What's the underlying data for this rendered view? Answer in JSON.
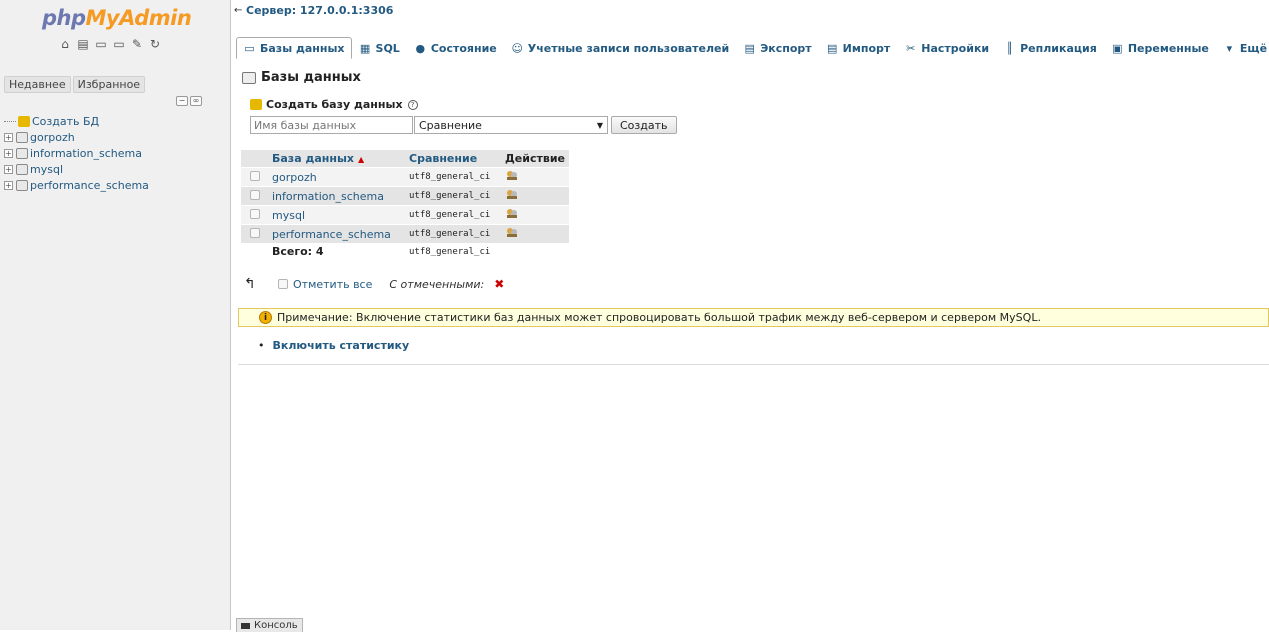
{
  "sidebar": {
    "logo_php": "php",
    "logo_myadmin": "MyAdmin",
    "recent": "Недавнее",
    "favorites": "Избранное",
    "tree": [
      {
        "label": "Создать БД"
      },
      {
        "label": "gorpozh"
      },
      {
        "label": "information_schema"
      },
      {
        "label": "mysql"
      },
      {
        "label": "performance_schema"
      }
    ]
  },
  "header": {
    "server": "Сервер: 127.0.0.1:3306",
    "tabs": [
      {
        "label": "Базы данных",
        "active": true
      },
      {
        "label": "SQL"
      },
      {
        "label": "Состояние"
      },
      {
        "label": "Учетные записи пользователей"
      },
      {
        "label": "Экспорт"
      },
      {
        "label": "Импорт"
      },
      {
        "label": "Настройки"
      },
      {
        "label": "Репликация"
      },
      {
        "label": "Переменные"
      },
      {
        "label": "Ещё"
      }
    ]
  },
  "main": {
    "title": "Базы данных",
    "create": {
      "label": "Создать базу данных",
      "placeholder": "Имя базы данных",
      "collation": "Сравнение",
      "button": "Создать"
    },
    "table": {
      "headers": {
        "db": "База данных",
        "collation": "Сравнение",
        "action": "Действие"
      },
      "rows": [
        {
          "name": "gorpozh",
          "collation": "utf8_general_ci"
        },
        {
          "name": "information_schema",
          "collation": "utf8_general_ci"
        },
        {
          "name": "mysql",
          "collation": "utf8_general_ci"
        },
        {
          "name": "performance_schema",
          "collation": "utf8_general_ci"
        }
      ],
      "total_label": "Всего: 4",
      "total_collation": "utf8_general_ci"
    },
    "check_all": "Отметить все",
    "with_selected": "С отмеченными:",
    "notice": "Примечание: Включение статистики баз данных может спровоцировать большой трафик между веб-сервером и сервером MySQL.",
    "enable_stats": "Включить статистику",
    "console": "Консоль"
  },
  "colors": {
    "link": "#235a81",
    "logo_php": "#6c78af",
    "logo_myadmin": "#f59a23",
    "notice_bg": "#ffffdd"
  }
}
